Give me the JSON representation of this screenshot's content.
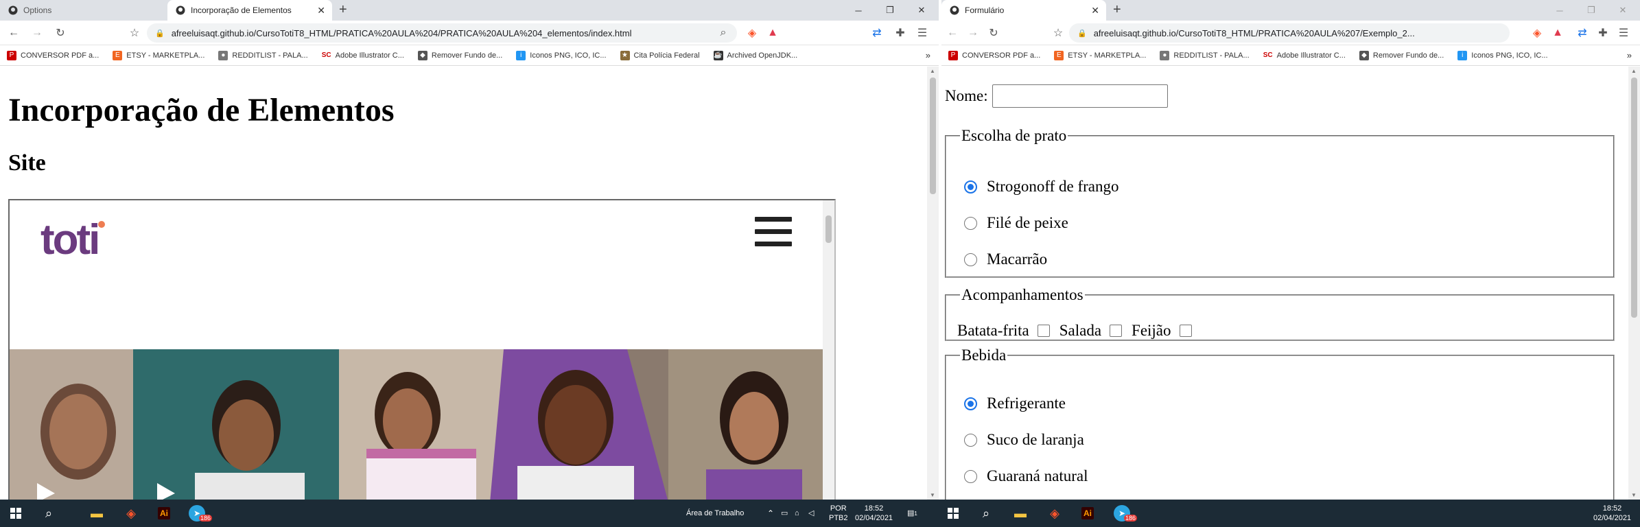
{
  "left_window": {
    "tabs": [
      {
        "title": "Options",
        "active": false
      },
      {
        "title": "Incorporação de Elementos",
        "active": true
      }
    ],
    "address": "afreeluisaqt.github.io/CursoTotiT8_HTML/PRATICA%20AULA%204/PRATICA%20AULA%204_elementos/index.html",
    "page": {
      "heading": "Incorporação de Elementos",
      "subheading": "Site",
      "embedded_logo": "toti"
    }
  },
  "right_window": {
    "tabs": [
      {
        "title": "Formulário",
        "active": true
      }
    ],
    "address": "afreeluisaqt.github.io/CursoTotiT8_HTML/PRATICA%20AULA%207/Exemplo_2...",
    "form": {
      "nome_label": "Nome:",
      "nome_value": "",
      "prato": {
        "legend": "Escolha de prato",
        "options": [
          {
            "label": "Strogonoff de frango",
            "checked": true
          },
          {
            "label": "Filé de peixe",
            "checked": false
          },
          {
            "label": "Macarrão",
            "checked": false
          }
        ]
      },
      "acompanhamentos": {
        "legend": "Acompanhamentos",
        "options": [
          {
            "label": "Batata-frita",
            "checked": false
          },
          {
            "label": "Salada",
            "checked": false
          },
          {
            "label": "Feijão",
            "checked": false
          }
        ]
      },
      "bebida": {
        "legend": "Bebida",
        "options": [
          {
            "label": "Refrigerante",
            "checked": true
          },
          {
            "label": "Suco de laranja",
            "checked": false
          },
          {
            "label": "Guaraná natural",
            "checked": false
          }
        ]
      }
    }
  },
  "bookmarks": [
    {
      "label": "CONVERSOR PDF a...",
      "icon": "pdf-icon"
    },
    {
      "label": "ETSY - MARKETPLA...",
      "icon": "etsy-icon"
    },
    {
      "label": "REDDITLIST - PALA...",
      "icon": "reddit-icon"
    },
    {
      "label": "Adobe Illustrator C...",
      "icon": "sc-icon"
    },
    {
      "label": "Remover Fundo de...",
      "icon": "removebg-icon"
    },
    {
      "label": "Iconos PNG, ICO, IC...",
      "icon": "icons-icon"
    },
    {
      "label": "Cita Polícia Federal",
      "icon": "badge-icon"
    },
    {
      "label": "Archived OpenJDK...",
      "icon": "java-icon"
    }
  ],
  "bookmarks_right": [
    {
      "label": "CONVERSOR PDF a...",
      "icon": "pdf-icon"
    },
    {
      "label": "ETSY - MARKETPLA...",
      "icon": "etsy-icon"
    },
    {
      "label": "REDDITLIST - PALA...",
      "icon": "reddit-icon"
    },
    {
      "label": "Adobe Illustrator C...",
      "icon": "sc-icon"
    },
    {
      "label": "Remover Fundo de...",
      "icon": "removebg-icon"
    },
    {
      "label": "Iconos PNG, ICO, IC...",
      "icon": "icons-icon"
    }
  ],
  "taskbar": {
    "left": {
      "desktop_label": "Área de Trabalho",
      "lang": "POR",
      "layout": "PTB2",
      "time": "18:52",
      "date": "02/04/2021",
      "notification_count": "1"
    },
    "right": {
      "time": "18:52",
      "date": "02/04/2021"
    },
    "telegram_badge": "186"
  },
  "colors": {
    "brand_purple": "#6b3b7f",
    "radio_blue": "#1a73e8",
    "taskbar_bg": "#1c2b36"
  }
}
